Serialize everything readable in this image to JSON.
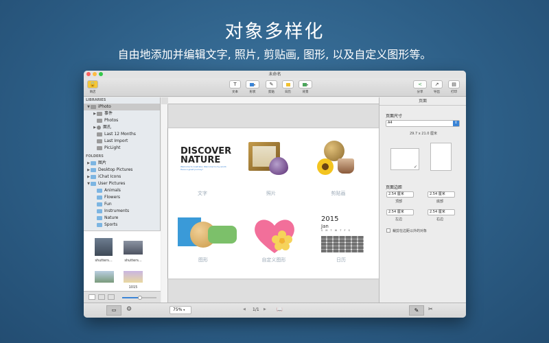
{
  "promo": {
    "headline": "对象多样化",
    "subline": "自由地添加并编辑文字, 照片, 剪贴画, 图形, 以及自定义图形等。"
  },
  "window": {
    "title": "未命名"
  },
  "toolbar": {
    "left_label": "商店",
    "tools": [
      {
        "label": "文本",
        "glyph": "T"
      },
      {
        "label": "形状",
        "glyph": ""
      },
      {
        "label": "剪贴",
        "glyph": "✎"
      },
      {
        "label": "日历",
        "glyph": ""
      },
      {
        "label": "背景",
        "glyph": ""
      }
    ],
    "right": [
      {
        "label": "分享",
        "glyph": "<"
      },
      {
        "label": "导出",
        "glyph": "↗"
      },
      {
        "label": "打印",
        "glyph": "▤"
      }
    ]
  },
  "sidebar": {
    "libraries_header": "LIBRARIES",
    "libraries": [
      {
        "label": "iPhoto",
        "tri": "▼",
        "indent": 0,
        "icon": "photo",
        "selected": true
      },
      {
        "label": "事件",
        "tri": "▶",
        "indent": 1,
        "icon": "photo",
        "selected": false
      },
      {
        "label": "Photos",
        "tri": "",
        "indent": 1,
        "icon": "photo",
        "selected": false
      },
      {
        "label": "面孔",
        "tri": "▶",
        "indent": 1,
        "icon": "person",
        "selected": false
      },
      {
        "label": "Last 12 Months",
        "tri": "",
        "indent": 1,
        "icon": "photo",
        "selected": false
      },
      {
        "label": "Last Import",
        "tri": "",
        "indent": 1,
        "icon": "photo",
        "selected": false
      },
      {
        "label": "PicLight",
        "tri": "",
        "indent": 1,
        "icon": "photo",
        "selected": false
      }
    ],
    "folders_header": "FOLDERS",
    "folders": [
      {
        "label": "图片",
        "tri": "▶",
        "indent": 0
      },
      {
        "label": "Desktop Pictures",
        "tri": "▶",
        "indent": 0
      },
      {
        "label": "iChat Icons",
        "tri": "▶",
        "indent": 0
      },
      {
        "label": "User Pictures",
        "tri": "▼",
        "indent": 0
      },
      {
        "label": "Animals",
        "tri": "",
        "indent": 1
      },
      {
        "label": "Flowers",
        "tri": "",
        "indent": 1
      },
      {
        "label": "Fun",
        "tri": "",
        "indent": 1
      },
      {
        "label": "Instruments",
        "tri": "",
        "indent": 1
      },
      {
        "label": "Nature",
        "tri": "",
        "indent": 1
      },
      {
        "label": "Sports",
        "tri": "",
        "indent": 1
      }
    ],
    "thumb_caption_1": "shutters...",
    "thumb_caption_2": "shutters...",
    "thumb_caption_3": "",
    "thumb_caption_4": "1015"
  },
  "canvas": {
    "discover_line1": "DISCOVER",
    "discover_line2": "NATURE",
    "discover_small": "Welcome to Australia: Welcome to my world. Have a great journey!",
    "captions": {
      "text": "文字",
      "photo": "照片",
      "clipart": "剪贴画",
      "shape": "图形",
      "custom_shape": "自定义图形",
      "calendar": "日历"
    },
    "calendar_year": "2015",
    "calendar_month": "Jan",
    "calendar_days": "S M T W T F S"
  },
  "inspector": {
    "tab": "页面",
    "page_size_label": "页面尺寸",
    "page_size_value": "A4",
    "page_dims": "29.7 x 21.0 厘米",
    "margins_label": "页面边距",
    "margin_top": "2.54 厘米",
    "margin_top_label": "顶部",
    "margin_bottom": "2.54 厘米",
    "margin_bottom_label": "底部",
    "margin_left": "2.54 厘米",
    "margin_left_label": "左边",
    "margin_right": "2.54 厘米",
    "margin_right_label": "右边",
    "clip_label": "裁剪在边距以外的对象"
  },
  "status": {
    "zoom": "75%",
    "page_indicator": "1/1"
  },
  "colors": {
    "background": "#2c5d85",
    "accent_blue": "#3a84d6",
    "caption_gray": "#9aa8b6"
  }
}
